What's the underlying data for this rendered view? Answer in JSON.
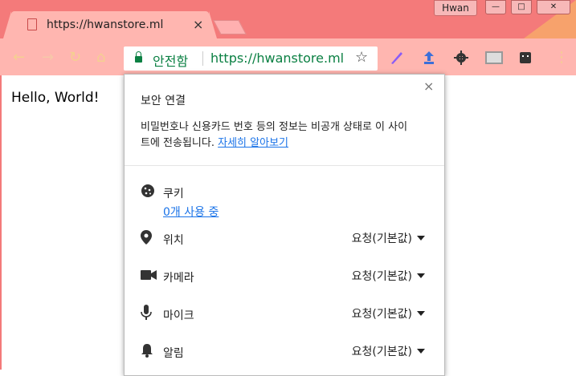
{
  "window": {
    "user": "Hwan",
    "minimize": "—",
    "maximize": "□",
    "close": "✕"
  },
  "tab": {
    "title": "https://hwanstore.ml",
    "close": "×"
  },
  "toolbar": {
    "back": "←",
    "forward": "→",
    "reload": "↻",
    "home": "⌂",
    "secure_label": "안전함",
    "url": "https://hwanstore.ml",
    "bookmark_star": "☆",
    "menu": "⋮"
  },
  "page": {
    "text": "Hello, World!"
  },
  "popup": {
    "close": "×",
    "heading": "보안 연결",
    "description": "비밀번호나 신용카드 번호 등의 정보는 비공개 상태로 이 사이트에 전송됩니다.",
    "learn_more": "자세히 알아보기",
    "cookies": {
      "label": "쿠키",
      "link": "0개 사용 중"
    },
    "permissions": [
      {
        "label": "위치",
        "value": "요청(기본값)",
        "icon": "location-pin-icon"
      },
      {
        "label": "카메라",
        "value": "요청(기본값)",
        "icon": "camera-icon"
      },
      {
        "label": "마이크",
        "value": "요청(기본값)",
        "icon": "microphone-icon"
      },
      {
        "label": "알림",
        "value": "요청(기본값)",
        "icon": "bell-icon"
      }
    ]
  },
  "colors": {
    "frame": "#f47a7a",
    "tab": "#ffb6b0",
    "secure_green": "#0b8043",
    "link_blue": "#1a73e8"
  }
}
